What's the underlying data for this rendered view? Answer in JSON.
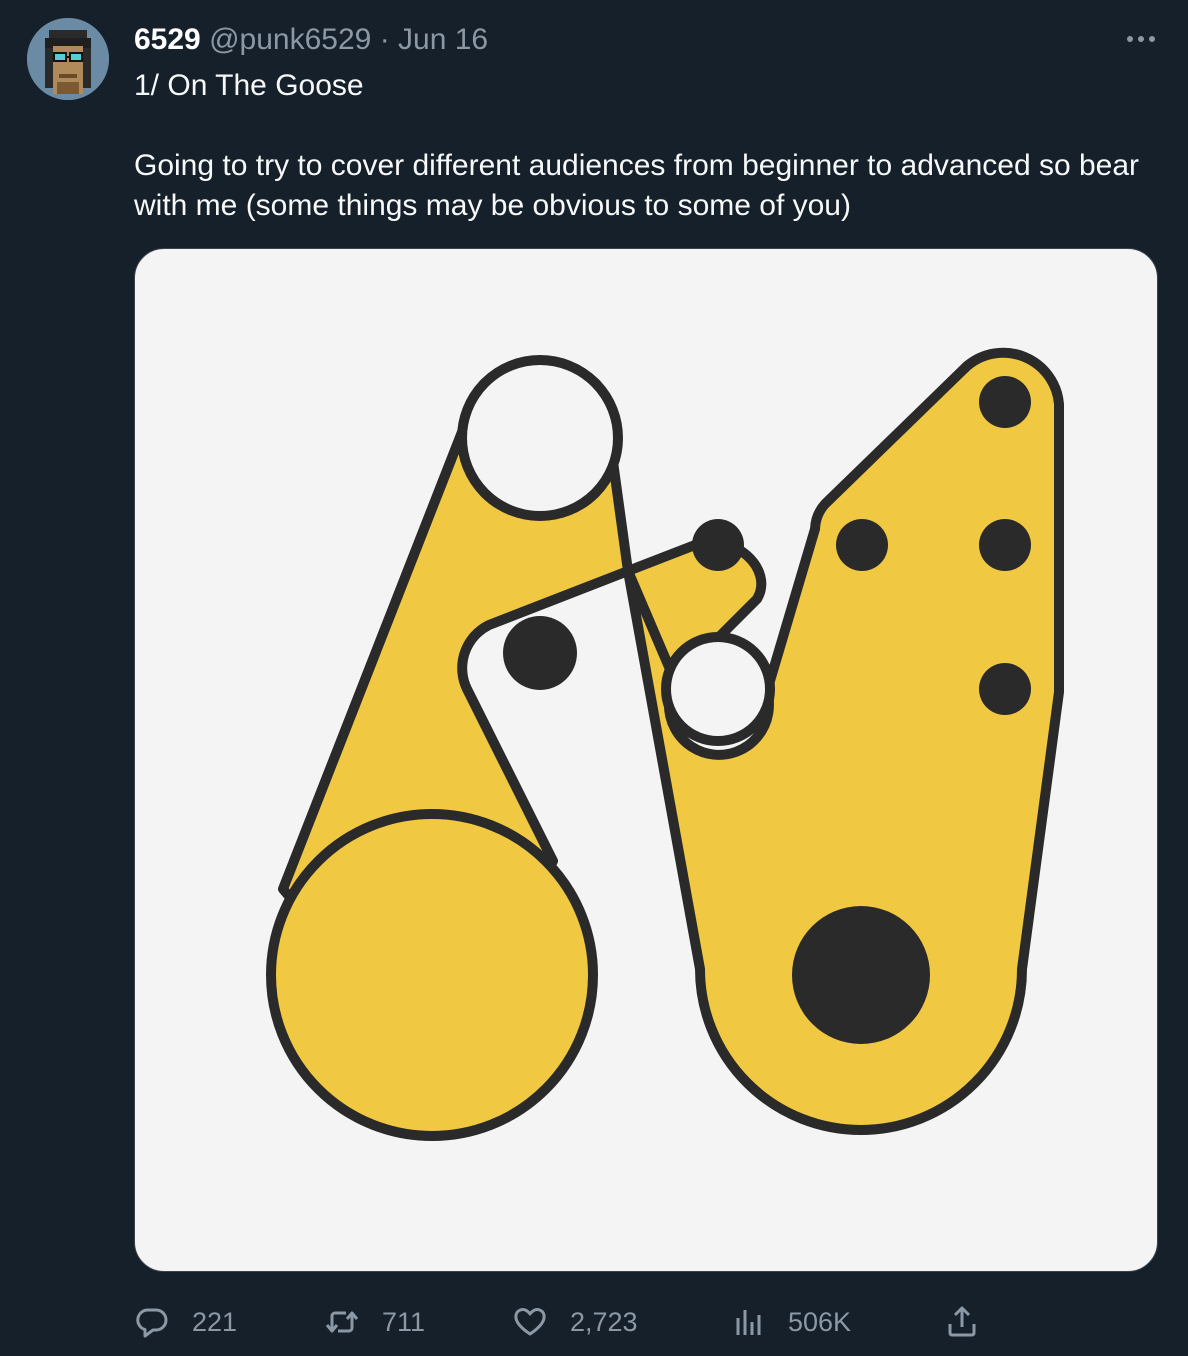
{
  "tweet": {
    "display_name": "6529",
    "handle": "@punk6529",
    "separator": "·",
    "date": "Jun 16",
    "text_line1": "1/ On The Goose",
    "text_line2": "Going to try to cover different audiences from beginner to advanced so bear with me (some things may be obvious to some of you)"
  },
  "actions": {
    "replies": "221",
    "retweets": "711",
    "likes": "2,723",
    "views": "506K"
  },
  "icons": {
    "more": "more-horizontal-icon",
    "reply": "reply-icon",
    "retweet": "retweet-icon",
    "like": "heart-icon",
    "views": "views-chart-icon",
    "share": "share-icon"
  },
  "colors": {
    "background": "#15202b",
    "text": "#f7f9f9",
    "secondary_text": "#8b98a5",
    "logo_yellow": "#f0c841",
    "logo_dark": "#2b2a2a",
    "media_background": "#f4f4f4"
  }
}
